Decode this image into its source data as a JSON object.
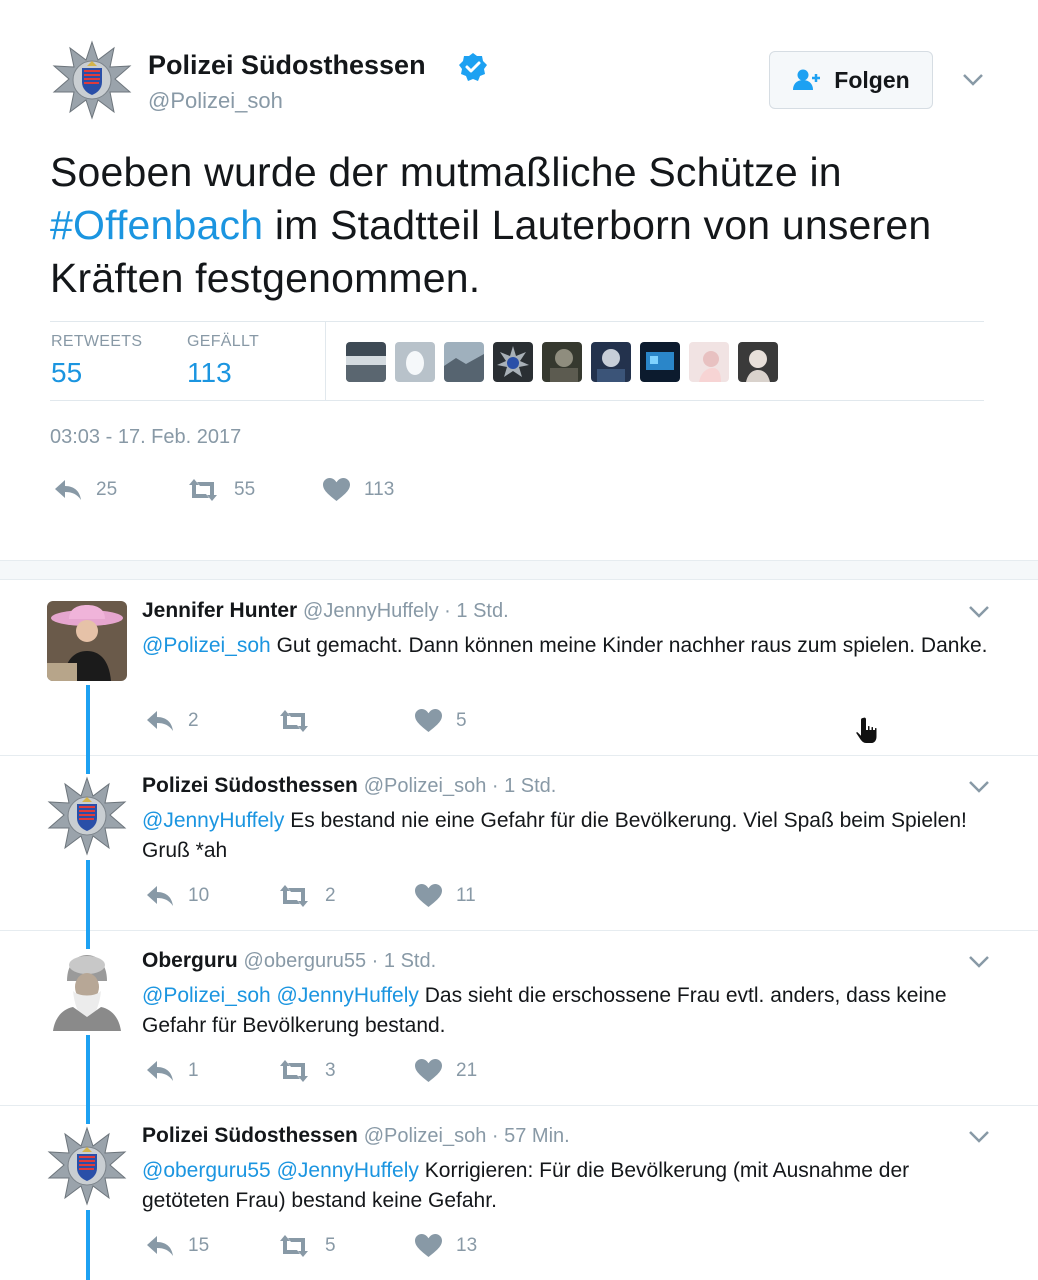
{
  "main_tweet": {
    "author": {
      "name": "Polizei Südosthessen",
      "handle": "@Polizei_soh",
      "verified": true,
      "avatar_icon": "police-star-badge-icon"
    },
    "follow_label": "Folgen",
    "text_before": "Soeben wurde der mutmaßliche Schütze in ",
    "hashtag": "#Offenbach",
    "text_after": " im Stadtteil Lauterborn von unseren Kräften festgenommen.",
    "stats": {
      "retweets_label": "RETWEETS",
      "retweets_value": "55",
      "likes_label": "GEFÄLLT",
      "likes_value": "113"
    },
    "liker_avatars": [
      "sea-photo",
      "egg-default",
      "landscape-photo",
      "police-star-badge",
      "portrait-photo",
      "portrait-photo",
      "blue-screen-photo",
      "portrait-photo",
      "portrait-photo"
    ],
    "timestamp": "03:03 - 17. Feb. 2017",
    "actions": {
      "reply": "25",
      "retweet": "55",
      "like": "113"
    }
  },
  "replies": [
    {
      "name": "Jennifer Hunter",
      "handle": "@JennyHuffely",
      "time": "1 Std.",
      "mentions": "@Polizei_soh",
      "text": "Gut gemacht. Dann können meine Kinder nachher raus zum spielen. Danke.",
      "actions": {
        "reply": "2",
        "retweet": "",
        "like": "5"
      }
    },
    {
      "name": "Polizei Südosthessen",
      "handle": "@Polizei_soh",
      "time": "1 Std.",
      "mentions": "@JennyHuffely",
      "text": "Es bestand nie eine Gefahr für die Bevölkerung. Viel Spaß beim Spielen! Gruß *ah",
      "actions": {
        "reply": "10",
        "retweet": "2",
        "like": "11"
      }
    },
    {
      "name": "Oberguru",
      "handle": "@oberguru55",
      "time": "1 Std.",
      "mentions": "@Polizei_soh @JennyHuffely",
      "text": "Das sieht die erschossene Frau evtl. anders, dass keine Gefahr für Bevölkerung bestand.",
      "actions": {
        "reply": "1",
        "retweet": "3",
        "like": "21"
      }
    },
    {
      "name": "Polizei Südosthessen",
      "handle": "@Polizei_soh",
      "time": "57 Min.",
      "mentions": "@oberguru55 @JennyHuffely",
      "text": "Korrigieren: Für die Bevölkerung (mit Ausnahme der getöteten Frau) bestand keine Gefahr.",
      "actions": {
        "reply": "15",
        "retweet": "5",
        "like": "13"
      }
    }
  ],
  "colors": {
    "link_blue": "#1b95e0",
    "thread_blue": "#1da1f2",
    "muted_gray": "#8899a6",
    "text_dark": "#14171a"
  }
}
